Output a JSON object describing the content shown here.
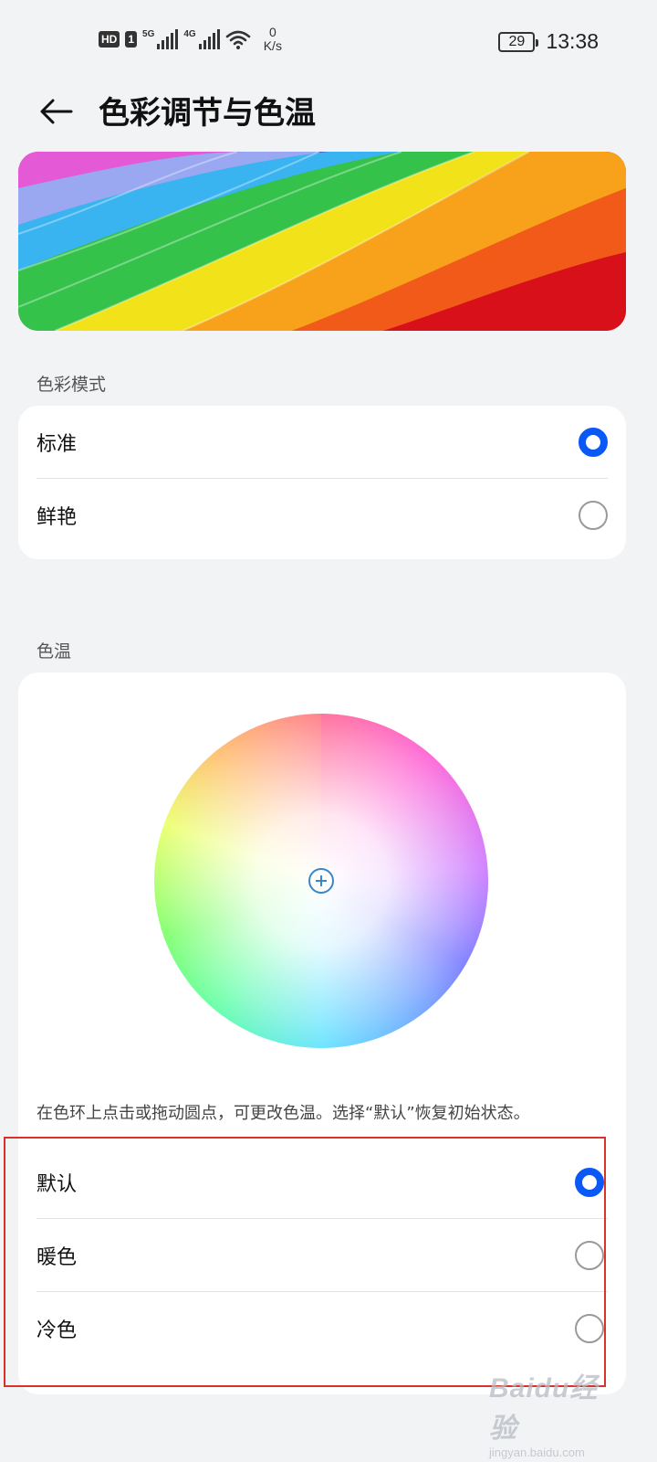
{
  "status_bar": {
    "hd_badge": "HD",
    "sim_badge": "1",
    "network_1": "5G",
    "network_2": "4G",
    "speed_value": "0",
    "speed_unit": "K/s",
    "battery_level": "29",
    "time": "13:38"
  },
  "header": {
    "title": "色彩调节与色温"
  },
  "color_mode": {
    "section_label": "色彩模式",
    "options": [
      {
        "label": "标准",
        "selected": true
      },
      {
        "label": "鲜艳",
        "selected": false
      }
    ]
  },
  "color_temperature": {
    "section_label": "色温",
    "hint": "在色环上点击或拖动圆点，可更改色温。选择“默认”恢复初始状态。",
    "options": [
      {
        "label": "默认",
        "selected": true
      },
      {
        "label": "暖色",
        "selected": false
      },
      {
        "label": "冷色",
        "selected": false
      }
    ]
  },
  "colors": {
    "accent": "#0a59f7",
    "annotation_box": "#d9322a"
  },
  "watermark": {
    "main": "Baidu经验",
    "sub": "jingyan.baidu.com"
  }
}
